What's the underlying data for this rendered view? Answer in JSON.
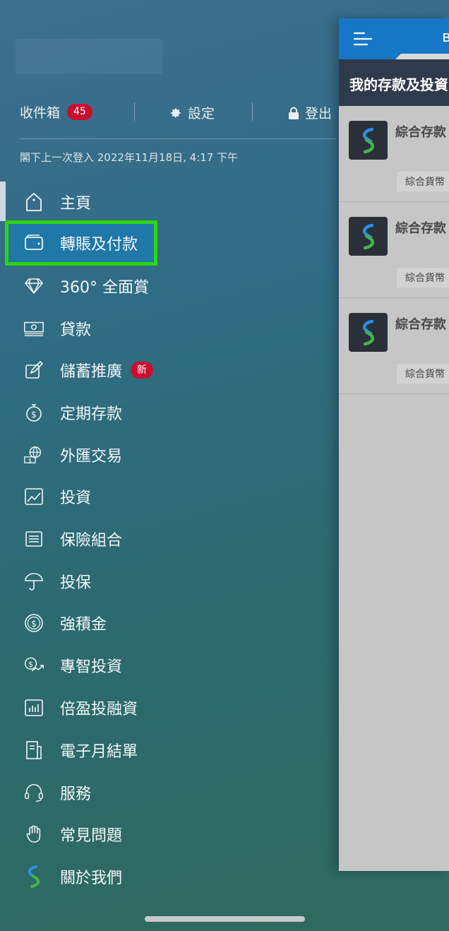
{
  "topbar": {
    "inbox_label": "收件箱",
    "inbox_count": "45",
    "settings_label": "設定",
    "logout_label": "登出"
  },
  "last_login": "閣下上一次登入 2022年11月18日, 4:17 下午",
  "menu": [
    {
      "label": "主頁",
      "icon": "home-icon"
    },
    {
      "label": "轉賬及付款",
      "icon": "wallet-icon",
      "active": true
    },
    {
      "label": "360° 全面賞",
      "icon": "diamond-icon"
    },
    {
      "label": "貸款",
      "icon": "cash-icon"
    },
    {
      "label": "儲蓄推廣",
      "icon": "edit-icon",
      "badge": "新"
    },
    {
      "label": "定期存款",
      "icon": "timer-dollar-icon"
    },
    {
      "label": "外匯交易",
      "icon": "globe-currency-icon"
    },
    {
      "label": "投資",
      "icon": "chart-line-icon"
    },
    {
      "label": "保險組合",
      "icon": "list-icon"
    },
    {
      "label": "投保",
      "icon": "umbrella-icon"
    },
    {
      "label": "強積金",
      "icon": "dollar-circle-icon"
    },
    {
      "label": "專智投資",
      "icon": "dollar-trend-icon"
    },
    {
      "label": "倍盈投融資",
      "icon": "bar-chart-icon"
    },
    {
      "label": "電子月結單",
      "icon": "statement-icon"
    },
    {
      "label": "服務",
      "icon": "headset-icon"
    },
    {
      "label": "常見問題",
      "icon": "hand-icon"
    },
    {
      "label": "關於我們",
      "icon": "bank-logo-icon"
    }
  ],
  "panel": {
    "header_title": "в",
    "subheader": "我的存款及投資",
    "cards": [
      {
        "title": "綜合存款",
        "tag": "綜合貨幣"
      },
      {
        "title": "綜合存款",
        "tag": "綜合貨幣"
      },
      {
        "title": "綜合存款",
        "tag": "綜合貨幣"
      }
    ]
  },
  "colors": {
    "accent_blue": "#1677c7",
    "highlight_green": "#2ed40d",
    "badge_red": "#c8102e"
  }
}
